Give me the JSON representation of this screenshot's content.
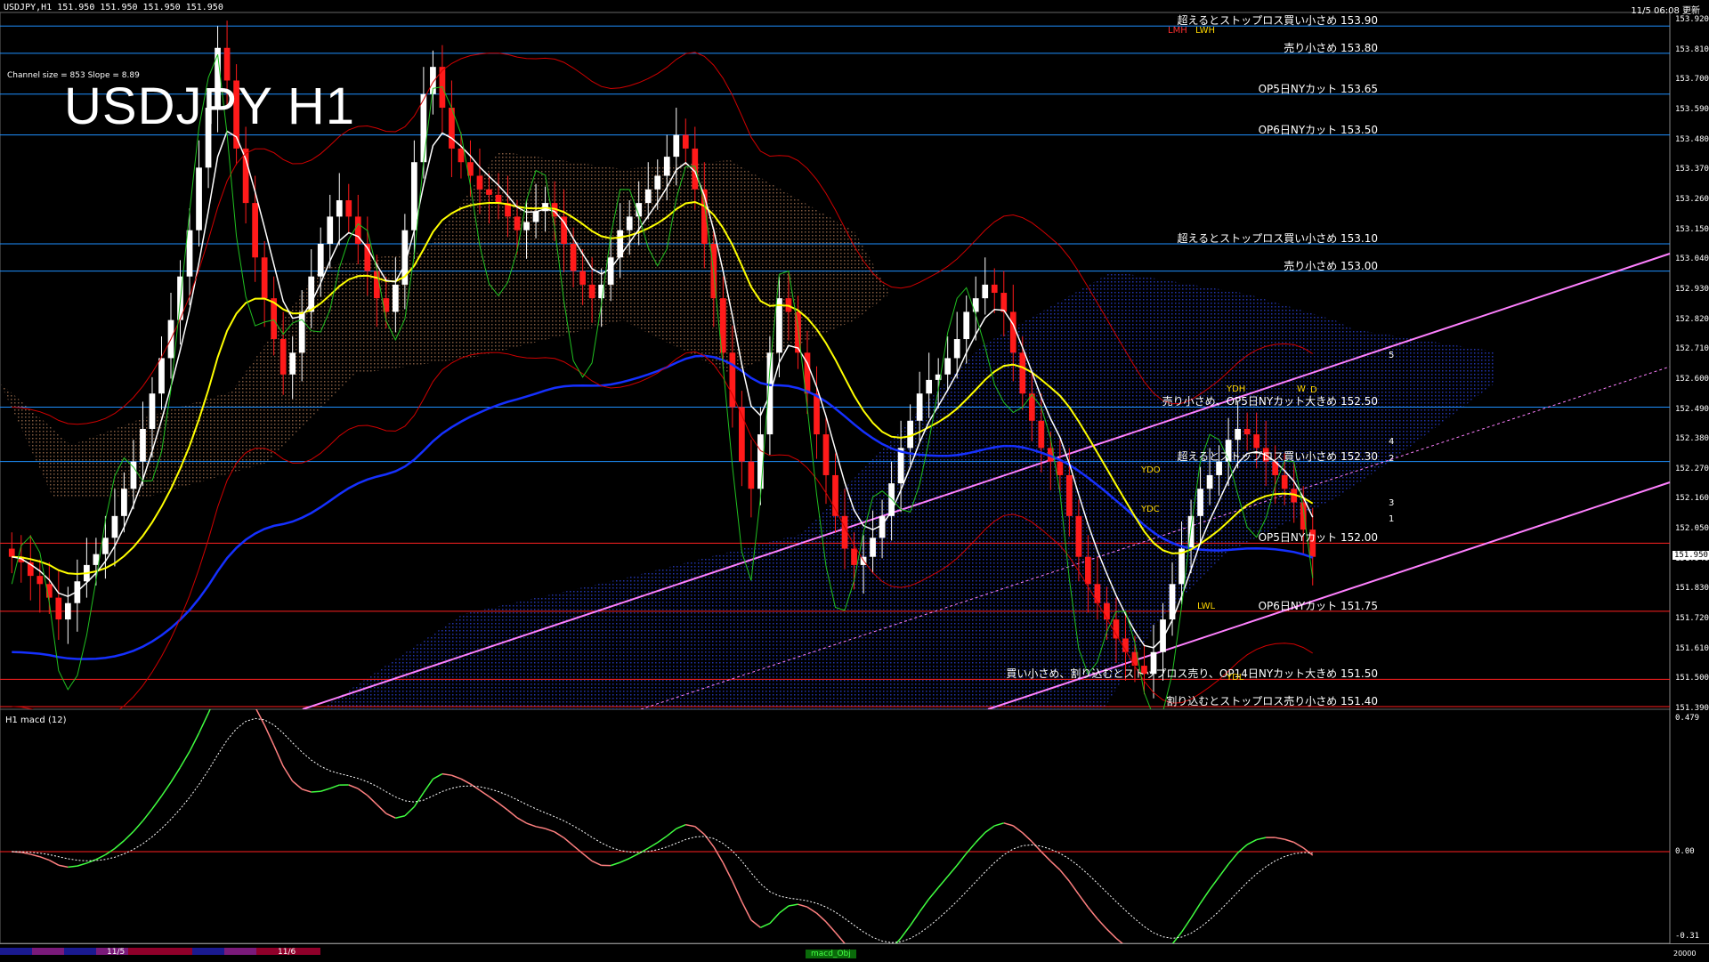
{
  "header": {
    "symbol_line": "USDJPY,H1  151.950 151.950 151.950 151.950",
    "title": "USDJPY H1",
    "channel_info": "Channel size = 853 Slope = 8.89",
    "clock": "11/5 06:08 更新",
    "macd_label": "H1  macd (12)"
  },
  "levels": [
    {
      "label": "超えるとストップロス買い小さめ 153.90",
      "price": 153.9,
      "color": "#1e90ff"
    },
    {
      "label": "売り小さめ 153.80",
      "price": 153.8,
      "color": "#1e90ff"
    },
    {
      "label": "OP5日NYカット 153.65",
      "price": 153.65,
      "color": "#1e90ff"
    },
    {
      "label": "OP6日NYカット 153.50",
      "price": 153.5,
      "color": "#1e90ff"
    },
    {
      "label": "超えるとストップロス買い小さめ 153.10",
      "price": 153.1,
      "color": "#1e90ff"
    },
    {
      "label": "売り小さめ 153.00",
      "price": 153.0,
      "color": "#1e90ff"
    },
    {
      "label": "売り小さめ、OP5日NYカット大きめ 152.50",
      "price": 152.5,
      "color": "#1e90ff"
    },
    {
      "label": "超えるとストップロス買い小さめ 152.30",
      "price": 152.3,
      "color": "#1e90ff"
    },
    {
      "label": "OP5日NYカット 152.00",
      "price": 152.0,
      "color": "#ff2020"
    },
    {
      "label": "OP6日NYカット 151.75",
      "price": 151.75,
      "color": "#ff2020"
    },
    {
      "label": "買い小さめ、割り込むとストップロス売り、OP14日NYカット大きめ 151.50",
      "price": 151.5,
      "color": "#ff2020"
    },
    {
      "label": "割り込むとストップロス売り小さめ 151.40",
      "price": 151.4,
      "color": "#ff2020"
    }
  ],
  "price_axis": [
    "153.920",
    "153.810",
    "153.700",
    "153.590",
    "153.480",
    "153.370",
    "153.260",
    "153.150",
    "153.040",
    "152.930",
    "152.820",
    "152.710",
    "152.600",
    "152.490",
    "152.380",
    "152.270",
    "152.160",
    "152.050",
    "151.940",
    "151.830",
    "151.720",
    "151.610",
    "151.500",
    "151.390"
  ],
  "current_price": "151.950",
  "macd_axis": [
    "0.479",
    "0.00",
    "-0.31"
  ],
  "bottom_axis_right": "20000",
  "date_tabs": [
    "11/5",
    "11/6"
  ],
  "bottom_tab": "macd_Obj",
  "box_labels": {
    "lmh": "LMH",
    "lwh": "LWH",
    "ydh": "YDH",
    "ydo": "YDO",
    "ydc": "YDC",
    "lwl": "LWL",
    "ydl": "YDL",
    "w": "W",
    "d": "D"
  },
  "channel_numbers": [
    "5",
    "4",
    "2",
    "3",
    "1"
  ],
  "colors": {
    "bull": "#ffffff",
    "bear": "#ff1a1a",
    "ema_short": "#ffffff",
    "ema_mid": "#ffff00",
    "ema_long": "#1530ff",
    "bollinger": "#d00000",
    "green_line": "#20c020",
    "channel": "#ff80ff",
    "macd_up": "#40ff40",
    "macd_down": "#ff8080",
    "macd_signal": "#ffffff",
    "zero_line": "#ff2020"
  },
  "chart_data": {
    "type": "candlestick",
    "title": "USDJPY H1",
    "ylim": [
      151.39,
      153.95
    ],
    "close": [
      151.95,
      151.93,
      151.88,
      151.85,
      151.8,
      151.72,
      151.78,
      151.86,
      151.92,
      151.96,
      152.02,
      152.1,
      152.2,
      152.3,
      152.42,
      152.55,
      152.68,
      152.82,
      152.98,
      153.15,
      153.38,
      153.6,
      153.82,
      153.7,
      153.45,
      153.25,
      153.05,
      152.9,
      152.75,
      152.62,
      152.7,
      152.85,
      152.98,
      153.1,
      153.2,
      153.26,
      153.2,
      153.1,
      153.0,
      152.9,
      152.85,
      152.95,
      153.15,
      153.4,
      153.65,
      153.75,
      153.6,
      153.45,
      153.4,
      153.35,
      153.3,
      153.28,
      153.25,
      153.2,
      153.15,
      153.18,
      153.22,
      153.25,
      153.2,
      153.1,
      153.0,
      152.95,
      152.9,
      152.95,
      153.05,
      153.15,
      153.2,
      153.25,
      153.3,
      153.35,
      153.42,
      153.5,
      153.45,
      153.3,
      153.1,
      152.9,
      152.7,
      152.5,
      152.3,
      152.2,
      152.4,
      152.7,
      152.9,
      152.85,
      152.7,
      152.55,
      152.4,
      152.25,
      152.1,
      151.98,
      151.92,
      151.95,
      152.02,
      152.1,
      152.22,
      152.35,
      152.45,
      152.55,
      152.6,
      152.62,
      152.68,
      152.75,
      152.85,
      152.9,
      152.95,
      152.92,
      152.85,
      152.7,
      152.55,
      152.45,
      152.35,
      152.3,
      152.25,
      152.1,
      151.95,
      151.85,
      151.78,
      151.72,
      151.65,
      151.6,
      151.55,
      151.52,
      151.6,
      151.72,
      151.85,
      151.98,
      152.1,
      152.2,
      152.25,
      152.3,
      152.38,
      152.42,
      152.4,
      152.35,
      152.3,
      152.25,
      152.2,
      152.15,
      152.05,
      151.95
    ]
  }
}
